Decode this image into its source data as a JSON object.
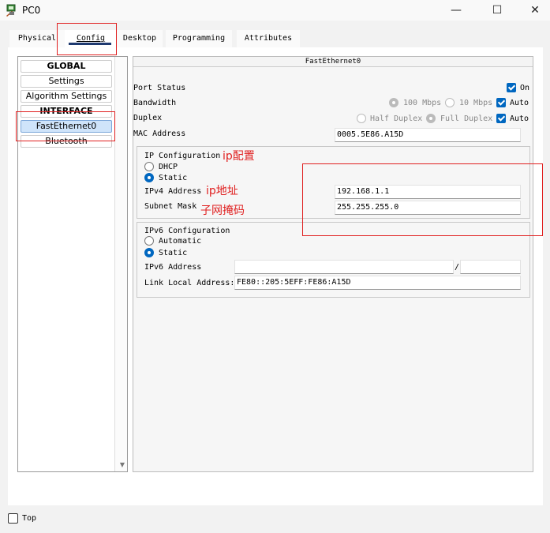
{
  "window": {
    "title": "PC0",
    "controls": {
      "minimize": "—",
      "maximize": "☐",
      "close": "✕"
    }
  },
  "tabs": [
    {
      "label": "Physical"
    },
    {
      "label": "Config"
    },
    {
      "label": "Desktop"
    },
    {
      "label": "Programming"
    },
    {
      "label": "Attributes"
    }
  ],
  "active_tab": "Config",
  "sidebar": {
    "items": [
      {
        "label": "GLOBAL"
      },
      {
        "label": "Settings"
      },
      {
        "label": "Algorithm Settings"
      },
      {
        "label": "INTERFACE"
      },
      {
        "label": "FastEthernet0"
      },
      {
        "label": "Bluetooth"
      }
    ],
    "selected": "FastEthernet0",
    "scroll_icon": "▼"
  },
  "interface_panel": {
    "title": "FastEthernet0",
    "port_status": {
      "label": "Port Status",
      "on_label": "On",
      "on_checked": true
    },
    "bandwidth": {
      "label": "Bandwidth",
      "opt_100": "100 Mbps",
      "opt_10": "10 Mbps",
      "auto_label": "Auto",
      "auto_checked": true
    },
    "duplex": {
      "label": "Duplex",
      "opt_half": "Half Duplex",
      "opt_full": "Full Duplex",
      "auto_label": "Auto",
      "auto_checked": true
    },
    "mac": {
      "label": "MAC Address",
      "value": "0005.5E86.A15D"
    },
    "ipv4": {
      "title": "IP Configuration",
      "dhcp_label": "DHCP",
      "static_label": "Static",
      "selected": "Static",
      "address_label": "IPv4 Address",
      "address_value": "192.168.1.1",
      "mask_label": "Subnet Mask",
      "mask_value": "255.255.255.0"
    },
    "ipv6": {
      "title": "IPv6 Configuration",
      "auto_label": "Automatic",
      "static_label": "Static",
      "selected": "Static",
      "address_label": "IPv6 Address",
      "address_value": "",
      "slash": "/",
      "prefix_value": "",
      "link_local_label": "Link Local Address:",
      "link_local_value": "FE80::205:5EFF:FE86:A15D"
    }
  },
  "annotations": {
    "ip_config": "ip配置",
    "ip_address": "ip地址",
    "subnet_mask": "子网掩码",
    "color": "#e02020"
  },
  "footer": {
    "top_label": "Top",
    "top_checked": false
  }
}
